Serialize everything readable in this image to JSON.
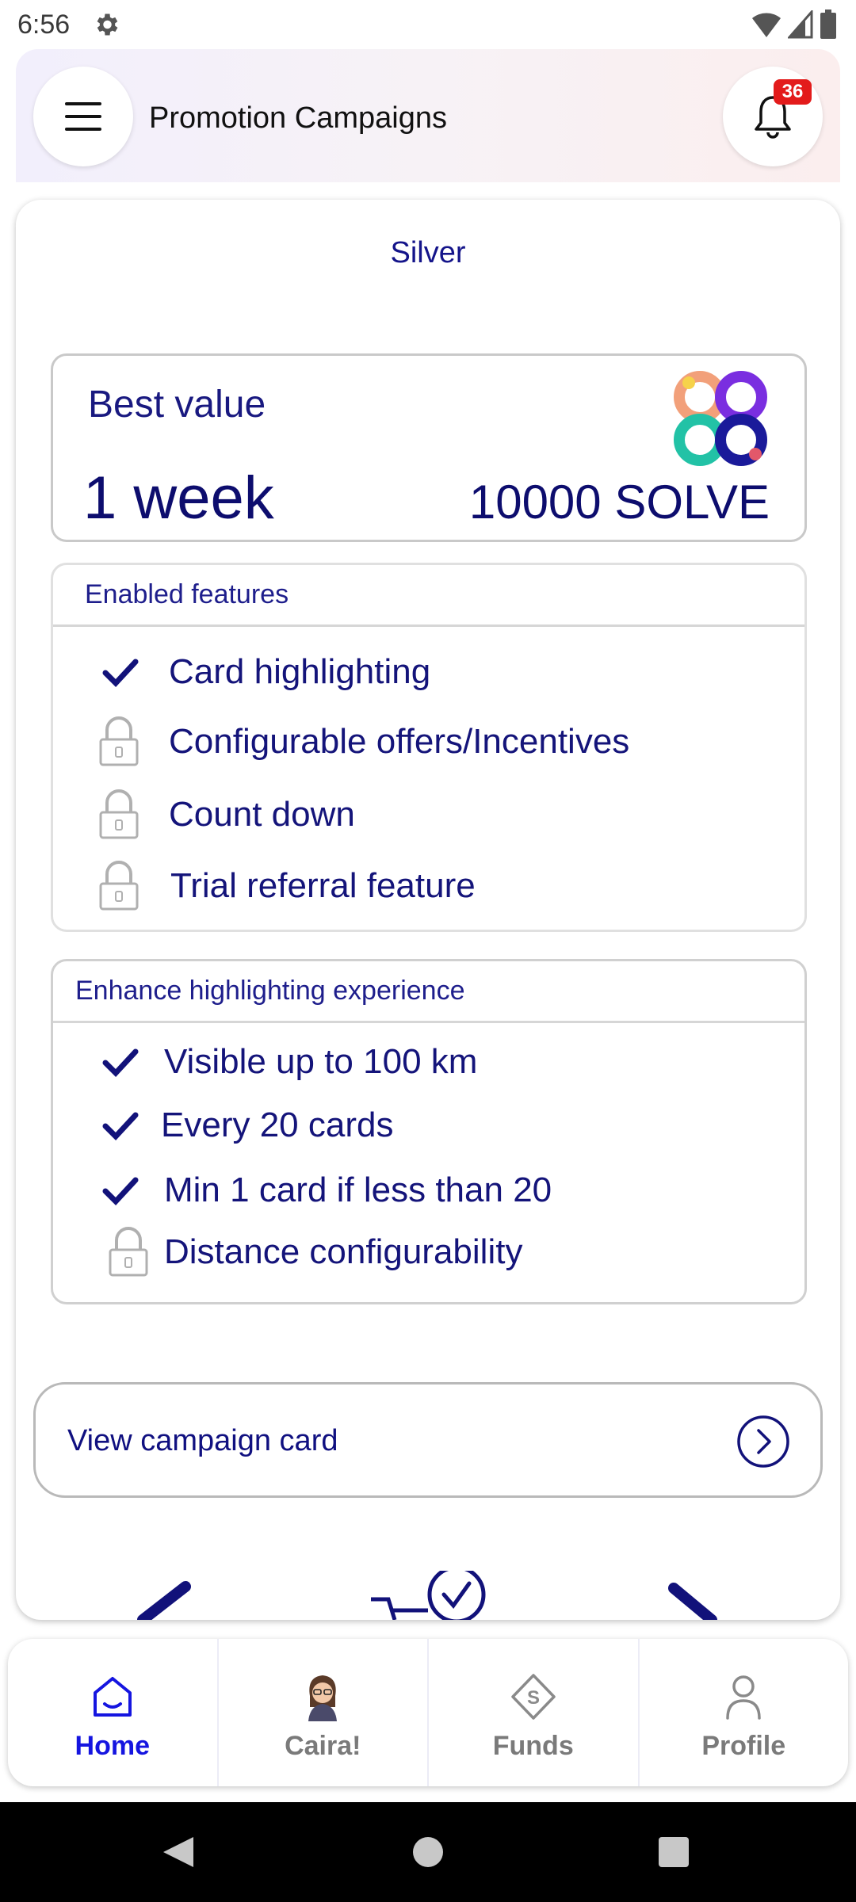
{
  "status_bar": {
    "time": "6:56"
  },
  "header": {
    "title": "Promotion Campaigns",
    "notification_count": "36"
  },
  "plan": {
    "tier": "Silver",
    "best_value_label": "Best value",
    "duration": "1 week",
    "price": "10000 SOLVE"
  },
  "enabled_features": {
    "title": "Enabled features",
    "items": [
      {
        "label": "Card highlighting",
        "status": "enabled"
      },
      {
        "label": "Configurable offers/Incentives",
        "status": "locked"
      },
      {
        "label": "Count down",
        "status": "locked"
      },
      {
        "label": "Trial referral feature",
        "status": "locked"
      }
    ]
  },
  "highlighting": {
    "title": "Enhance highlighting experience",
    "items": [
      {
        "label": "Visible up to 100 km",
        "status": "enabled"
      },
      {
        "label": "Every 20 cards",
        "status": "enabled"
      },
      {
        "label": "Min 1 card if less than 20",
        "status": "enabled"
      },
      {
        "label": "Distance configurability",
        "status": "locked"
      }
    ]
  },
  "view_campaign": {
    "label": "View campaign card"
  },
  "bottom_nav": {
    "items": [
      {
        "label": "Home",
        "icon": "home-icon",
        "active": true
      },
      {
        "label": "Caira!",
        "icon": "avatar-icon",
        "active": false
      },
      {
        "label": "Funds",
        "icon": "funds-icon",
        "active": false
      },
      {
        "label": "Profile",
        "icon": "profile-icon",
        "active": false
      }
    ]
  },
  "colors": {
    "primary_text": "#14147a",
    "accent_blue": "#1515e0",
    "badge_red": "#e31b1b"
  }
}
